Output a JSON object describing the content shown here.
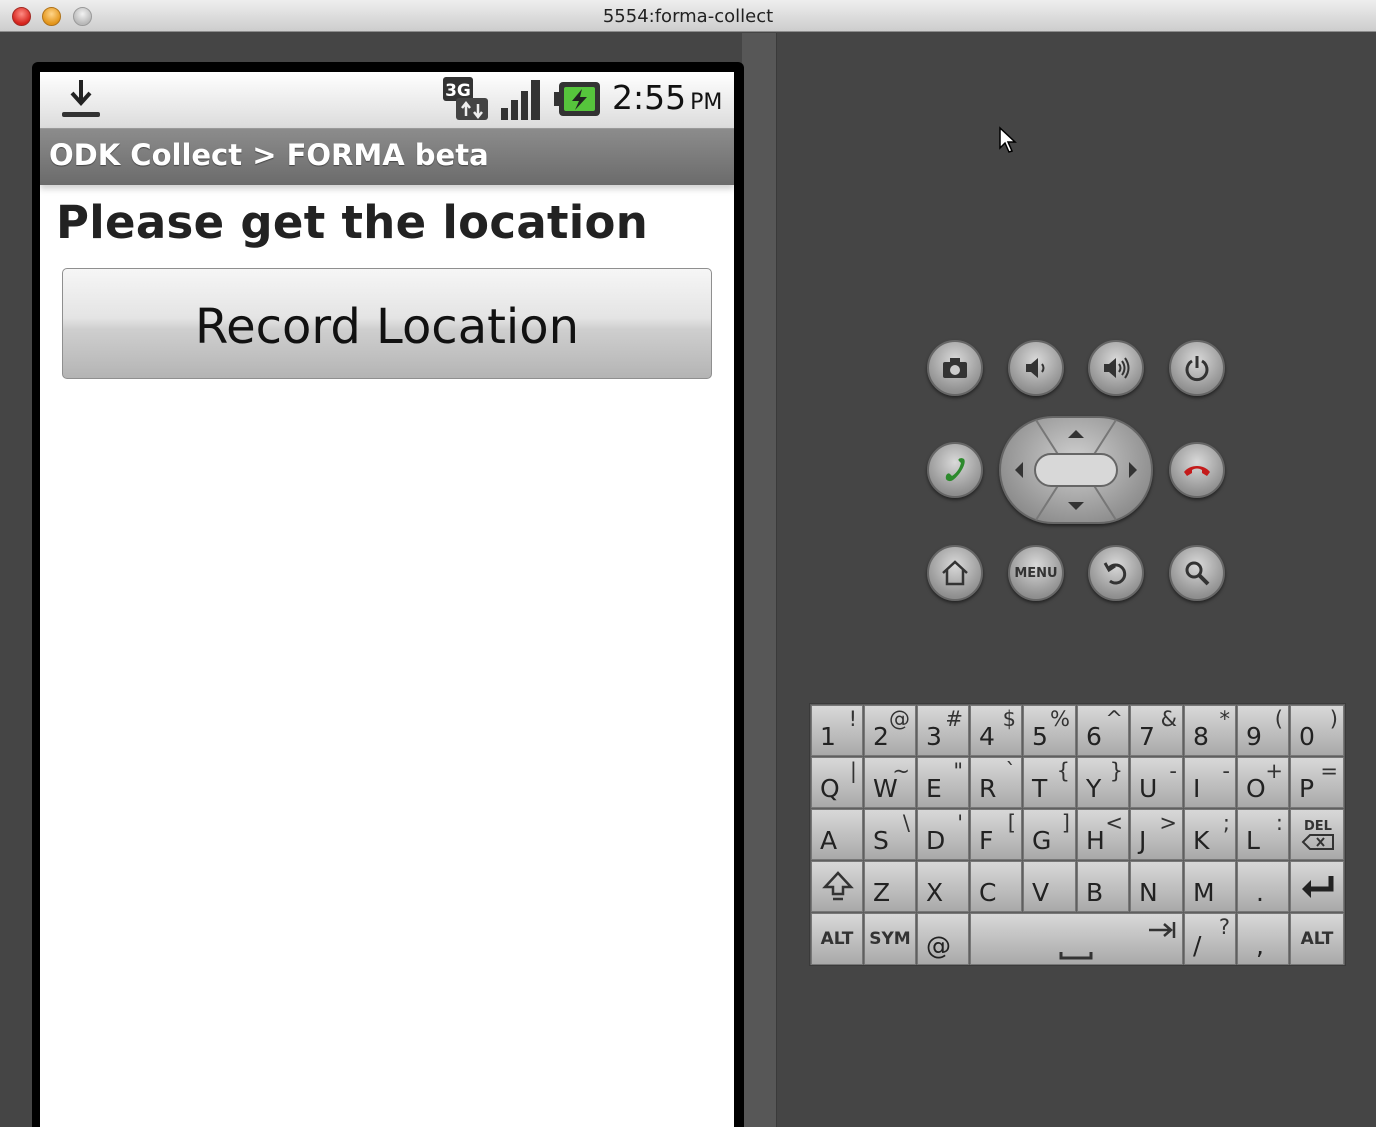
{
  "window": {
    "title": "5554:forma-collect"
  },
  "status_bar": {
    "time": "2:55",
    "ampm": "PM",
    "icons": [
      "download-icon",
      "3g-data-icon",
      "signal-icon",
      "battery-charging-icon"
    ]
  },
  "app_bar": {
    "title": "ODK Collect > FORMA beta"
  },
  "form": {
    "question": "Please get the location",
    "record_button": "Record Location"
  },
  "hardware_buttons": {
    "menu_label": "MENU",
    "row1": [
      "camera",
      "volume-down",
      "volume-up",
      "power"
    ],
    "row3": [
      "home",
      "menu",
      "back",
      "search"
    ]
  },
  "keyboard": {
    "rows": [
      [
        [
          "1",
          "!"
        ],
        [
          "2",
          "@"
        ],
        [
          "3",
          "#"
        ],
        [
          "4",
          "$"
        ],
        [
          "5",
          "%"
        ],
        [
          "6",
          "^"
        ],
        [
          "7",
          "&"
        ],
        [
          "8",
          "*"
        ],
        [
          "9",
          "("
        ],
        [
          "0",
          ")"
        ]
      ],
      [
        [
          "Q",
          "|"
        ],
        [
          "W",
          "~"
        ],
        [
          "E",
          "\""
        ],
        [
          "R",
          "`"
        ],
        [
          "T",
          "{"
        ],
        [
          "Y",
          "}"
        ],
        [
          "U",
          "-"
        ],
        [
          "I",
          "-"
        ],
        [
          "O",
          "+"
        ],
        [
          "P",
          "="
        ]
      ],
      [
        [
          "A",
          ""
        ],
        [
          "S",
          "\\"
        ],
        [
          "D",
          "'"
        ],
        [
          "F",
          "["
        ],
        [
          "G",
          "]"
        ],
        [
          "H",
          "<"
        ],
        [
          "J",
          ">"
        ],
        [
          "K",
          ";"
        ],
        [
          "L",
          ":"
        ]
      ],
      [
        [
          "Z",
          ""
        ],
        [
          "X",
          ""
        ],
        [
          "C",
          ""
        ],
        [
          "V",
          ""
        ],
        [
          "B",
          ""
        ],
        [
          "N",
          ""
        ],
        [
          "M",
          ""
        ],
        [
          ".",
          ""
        ]
      ],
      [
        [
          "/",
          "?"
        ],
        [
          ",",
          ""
        ]
      ]
    ],
    "labels": {
      "del": "DEL",
      "alt": "ALT",
      "sym": "SYM",
      "at": "@"
    }
  },
  "colors": {
    "call_green": "#2d8a2d",
    "end_red": "#c41a1a"
  }
}
